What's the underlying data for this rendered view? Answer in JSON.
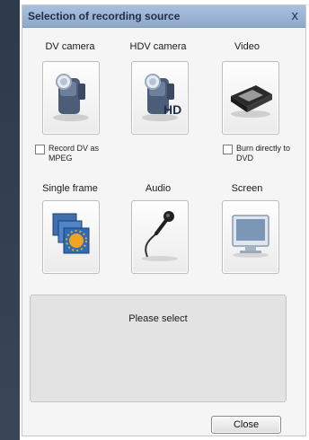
{
  "window": {
    "title": "Selection of recording source",
    "close_glyph": "x"
  },
  "sources": {
    "dv_camera": {
      "label": "DV camera",
      "icon": "dv-camera-icon"
    },
    "hdv_camera": {
      "label": "HDV camera",
      "icon": "hdv-camera-icon",
      "badge": "HD"
    },
    "video": {
      "label": "Video",
      "icon": "vhs-tape-icon"
    },
    "single_frame": {
      "label": "Single frame",
      "icon": "single-frame-icon"
    },
    "audio": {
      "label": "Audio",
      "icon": "microphone-icon"
    },
    "screen": {
      "label": "Screen",
      "icon": "monitor-icon"
    }
  },
  "options": {
    "record_dv_as_mpeg": {
      "label": "Record DV as MPEG",
      "checked": false
    },
    "burn_directly_to_dvd": {
      "label": "Burn directly to DVD",
      "checked": false
    }
  },
  "status": {
    "text": "Please select"
  },
  "buttons": {
    "close_label": "Close"
  },
  "colors": {
    "titlebar": "#9bb4d6",
    "window_bg": "#f5f5f5",
    "panel_bg": "#e3e3e3"
  }
}
